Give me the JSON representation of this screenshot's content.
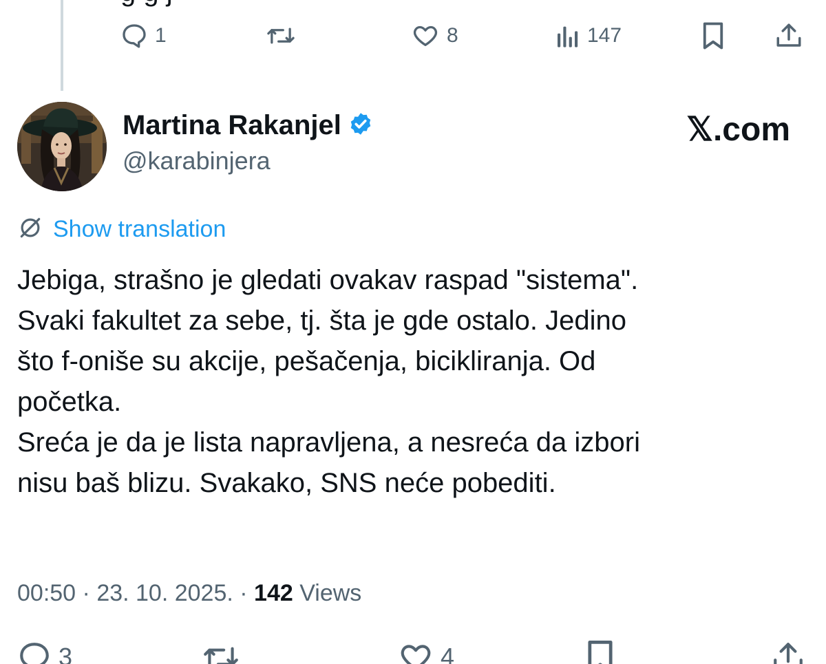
{
  "previous_tweet": {
    "partial_text": "g                  g                                     j",
    "actions": {
      "replies": "1",
      "likes": "8",
      "views": "147"
    }
  },
  "tweet": {
    "author_name": "Martina Rakanjel",
    "handle": "@karabinjera",
    "brand": "𝕏.com",
    "translate_label": "Show translation",
    "lines": [
      "Jebiga, strašno je gledati ovakav raspad \"sistema\".",
      "Svaki fakultet za sebe, tj. šta je gde ostalo. Jedino",
      "što f-oniše su akcije, pešačenja, bicikliranja. Od",
      "početka.",
      "Sreća je da je lista napravljena, a nesreća da izbori",
      "nisu baš blizu. Svakako, SNS neće pobediti."
    ],
    "time": "00:50",
    "sep1": " · ",
    "date": "23. 10. 2025.",
    "sep2": " · ",
    "views_count": "142",
    "views_label": " Views",
    "actions": {
      "replies": "3",
      "likes": "4"
    }
  },
  "colors": {
    "text_primary": "#0f1419",
    "text_secondary": "#536471",
    "link": "#1d9bf0",
    "verified": "#1d9bf0",
    "thread_line": "#cfd9de"
  }
}
